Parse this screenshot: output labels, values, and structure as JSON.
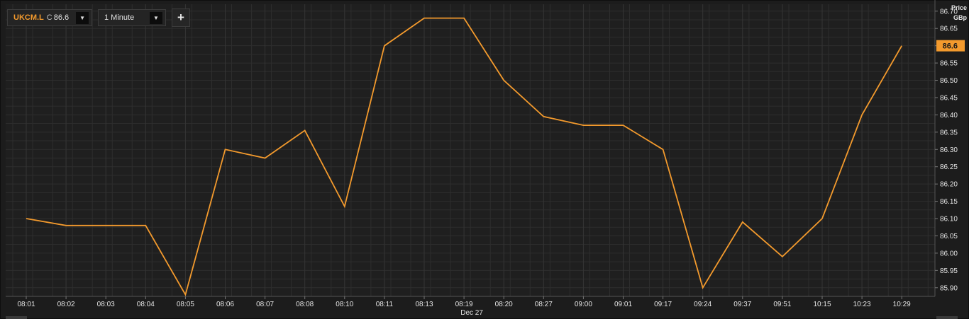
{
  "toolbar": {
    "symbol": "UKCM.L",
    "close_prefix": "C",
    "close_value": "86.6",
    "interval": "1 Minute",
    "add_icon": "plus-icon",
    "dropdown_icon": "caret-down-icon"
  },
  "y_axis": {
    "title": "Price",
    "unit": "GBp"
  },
  "current_price_label": "86.6",
  "colors": {
    "line": "#f39a2d",
    "background": "#1c1c1c",
    "grid": "#333333",
    "accent": "#f39a2d"
  },
  "chart_data": {
    "type": "line",
    "x": [
      "08:01",
      "08:02",
      "08:03",
      "08:04",
      "08:05",
      "08:06",
      "08:07",
      "08:08",
      "08:10",
      "08:11",
      "08:13",
      "08:19",
      "08:20",
      "08:27",
      "09:00",
      "09:01",
      "09:17",
      "09:24",
      "09:37",
      "09:51",
      "10:15",
      "10:23",
      "10:29"
    ],
    "values": [
      86.1,
      86.08,
      86.08,
      86.08,
      85.88,
      86.3,
      86.275,
      86.355,
      86.135,
      86.6,
      86.68,
      86.68,
      86.5,
      86.395,
      86.37,
      86.37,
      86.3,
      85.9,
      86.09,
      85.99,
      86.1,
      86.4,
      86.6
    ],
    "x_date_label": "Dec 27",
    "y_ticks": [
      "85.90",
      "85.95",
      "86.00",
      "86.05",
      "86.10",
      "86.15",
      "86.20",
      "86.25",
      "86.30",
      "86.35",
      "86.40",
      "86.45",
      "86.50",
      "86.55",
      "86.60",
      "86.65",
      "86.70"
    ],
    "ylim": [
      85.875,
      86.72
    ],
    "grid": true,
    "last_value_marker": 86.6
  }
}
